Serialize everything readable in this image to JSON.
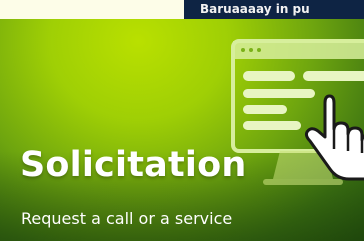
{
  "banner": {
    "text": "Baruaaaay in pu"
  },
  "card": {
    "title": "Solicitation",
    "subtitle": "Request a call or a service",
    "colors": {
      "gradient_light": "#b9e000",
      "gradient_dark": "#27570f",
      "text": "#ffffff",
      "banner_bg": "#0e2444"
    },
    "illustration": {
      "icons": [
        "monitor-icon",
        "pointer-hand-icon"
      ]
    }
  }
}
